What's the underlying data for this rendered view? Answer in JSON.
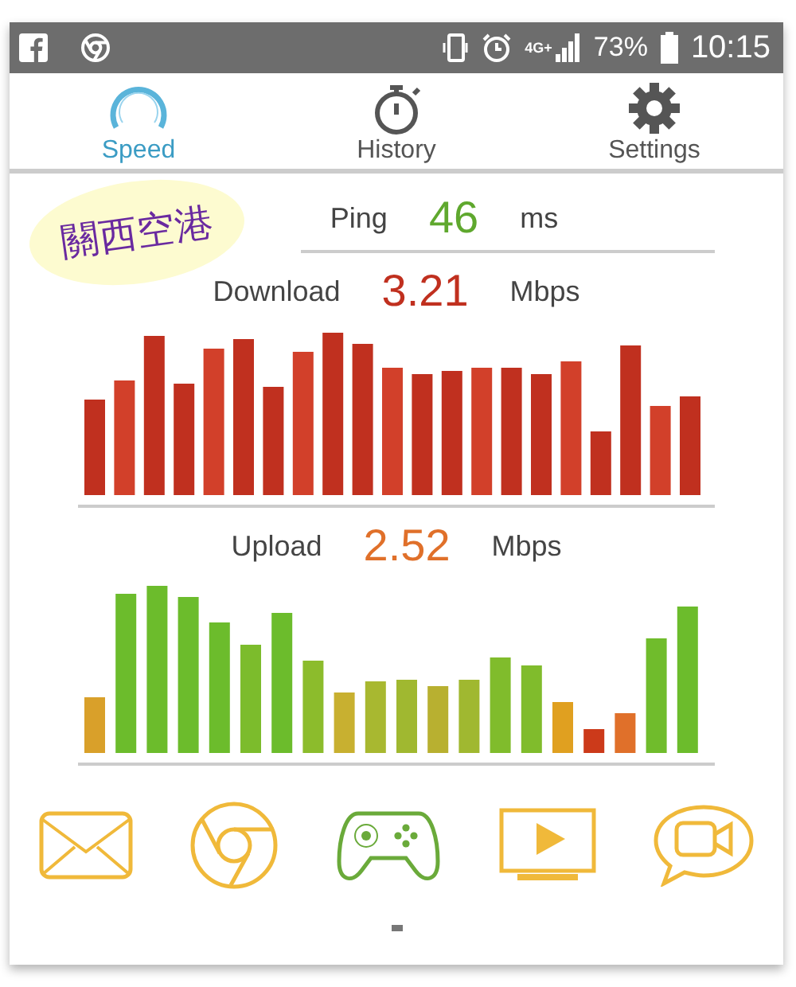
{
  "status_bar": {
    "battery": "73%",
    "network": "4G+",
    "time": "10:15"
  },
  "tabs": [
    {
      "label": "Speed",
      "kind": "speed",
      "selected": true
    },
    {
      "label": "History",
      "kind": "history",
      "selected": false
    },
    {
      "label": "Settings",
      "kind": "settings",
      "selected": false
    }
  ],
  "sticker": "關西空港",
  "ping": {
    "label": "Ping",
    "value": "46",
    "unit": "ms"
  },
  "download": {
    "label": "Download",
    "value": "3.21",
    "unit": "Mbps"
  },
  "upload": {
    "label": "Upload",
    "value": "2.52",
    "unit": "Mbps"
  },
  "apps": [
    {
      "kind": "mail",
      "color": "#f0b93a"
    },
    {
      "kind": "browser",
      "color": "#f0b93a"
    },
    {
      "kind": "game",
      "color": "#6aaa3a"
    },
    {
      "kind": "video",
      "color": "#f0b93a"
    },
    {
      "kind": "chat",
      "color": "#f0b93a"
    }
  ]
}
